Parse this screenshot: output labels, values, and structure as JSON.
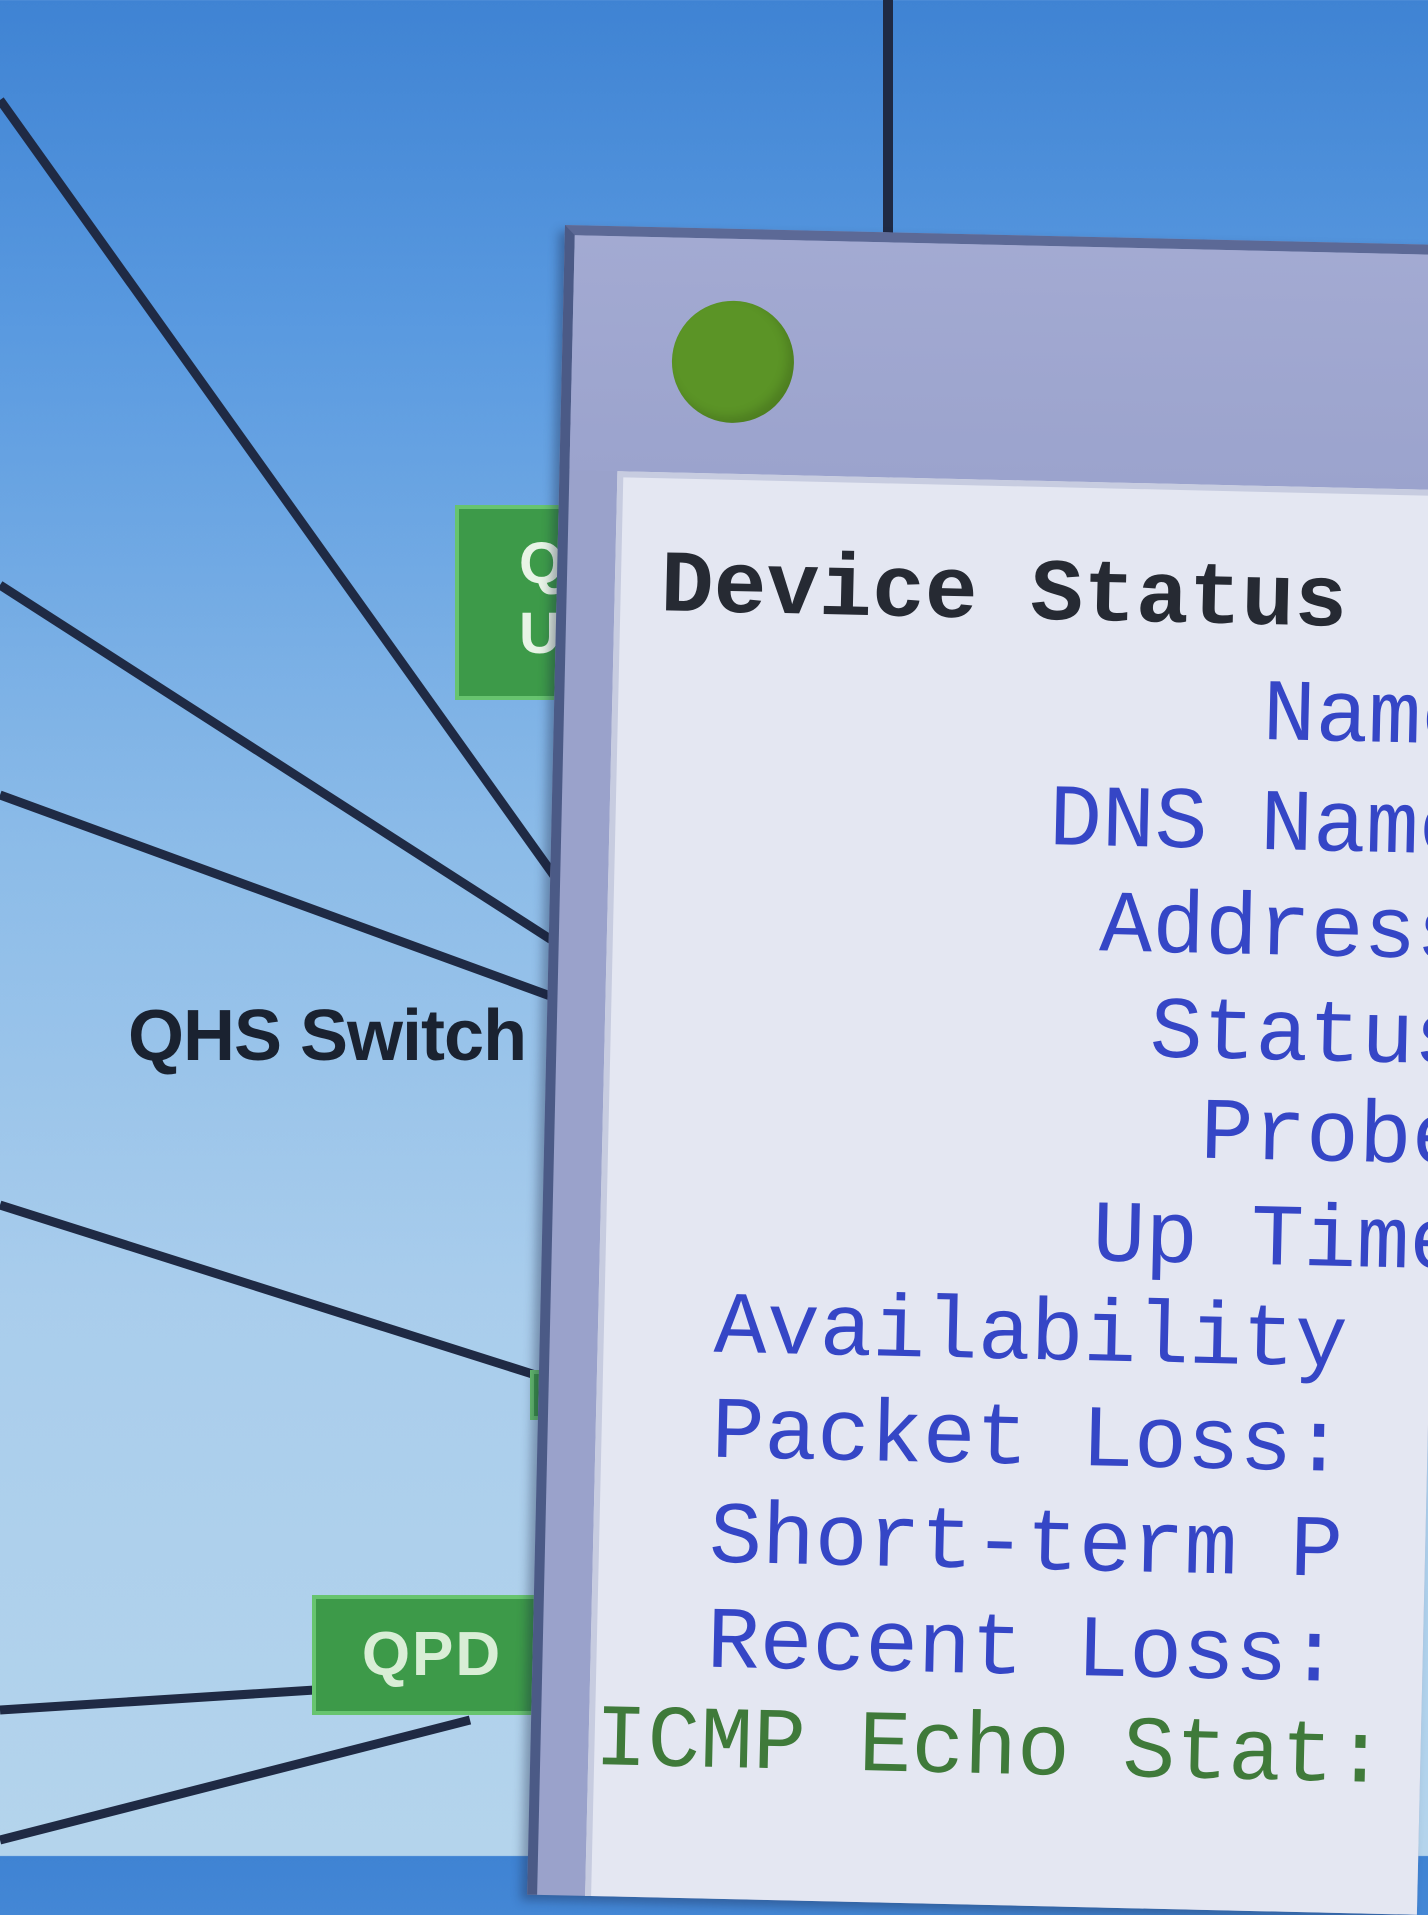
{
  "map": {
    "background_top": "#3f83d3",
    "background_bottom": "#b4d4ec",
    "link_color": "#1f2a44",
    "nodes": {
      "top_node_label": "Q\nU",
      "qpd_label": "QPD",
      "small_node_label": ""
    },
    "qhs_switch_label": "QHS Switch"
  },
  "status_window": {
    "status_indicator_color": "#5b9426",
    "title": "Device Status",
    "fields": {
      "name": "Name",
      "dns_name": "DNS Name",
      "address": "Address",
      "status": "Status",
      "probe": "Probe",
      "up_time": "Up Time",
      "availability": "Availability",
      "packet_loss": "Packet Loss:",
      "short_term": "Short-term P",
      "recent_loss": "Recent Loss:",
      "icmp_echo": "ICMP Echo Stat:"
    },
    "label_color": "#3546c6",
    "icmp_color": "#3f7a3a"
  }
}
